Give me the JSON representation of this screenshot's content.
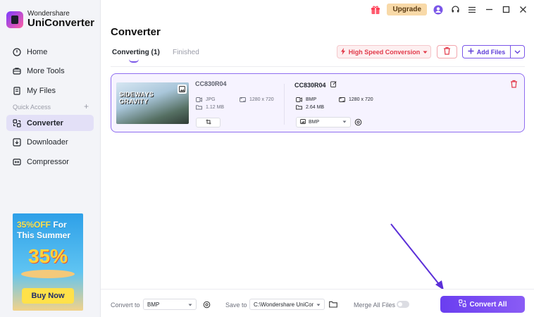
{
  "app": {
    "brand_top": "Wondershare",
    "brand_bottom": "UniConverter",
    "accent_color": "#7a56e8"
  },
  "titlebar": {
    "upgrade_label": "Upgrade",
    "icons": [
      "gift-icon",
      "avatar-icon",
      "headset-icon",
      "menu-icon",
      "minimize-icon",
      "maximize-icon",
      "close-icon"
    ]
  },
  "sidebar": {
    "items": [
      {
        "label": "Home",
        "icon": "home-icon"
      },
      {
        "label": "More Tools",
        "icon": "toolbox-icon"
      },
      {
        "label": "My Files",
        "icon": "files-icon"
      }
    ],
    "quick_access_label": "Quick Access",
    "quick_items": [
      {
        "label": "Converter",
        "icon": "converter-icon",
        "active": true
      },
      {
        "label": "Downloader",
        "icon": "download-icon"
      },
      {
        "label": "Compressor",
        "icon": "compress-icon"
      }
    ]
  },
  "promo": {
    "line1_accent": "35%OFF",
    "line1_rest": " For",
    "line2": "This Summer",
    "big": "35%",
    "button": "Buy Now"
  },
  "main": {
    "title": "Converter",
    "tabs": [
      {
        "label": "Converting (1)",
        "active": true
      },
      {
        "label": "Finished",
        "active": false
      }
    ],
    "high_speed_label": "High Speed Conversion",
    "add_files_label": "Add Files"
  },
  "file": {
    "thumb_text_1": "SIDEWAYS",
    "thumb_text_2": "GRAVITY",
    "source": {
      "name": "CC830R04",
      "format": "JPG",
      "resolution": "1280 x 720",
      "size": "1.12 MB"
    },
    "target": {
      "name": "CC830R04",
      "format": "BMP",
      "resolution": "1280 x 720",
      "size": "2.64 MB",
      "format_select": "BMP"
    }
  },
  "bottom": {
    "convert_to_label": "Convert to",
    "convert_to_value": "BMP",
    "save_to_label": "Save to",
    "save_to_value": "C:\\Wondershare UniCon",
    "merge_label": "Merge All Files",
    "merge_enabled": false,
    "convert_all_label": "Convert All"
  }
}
